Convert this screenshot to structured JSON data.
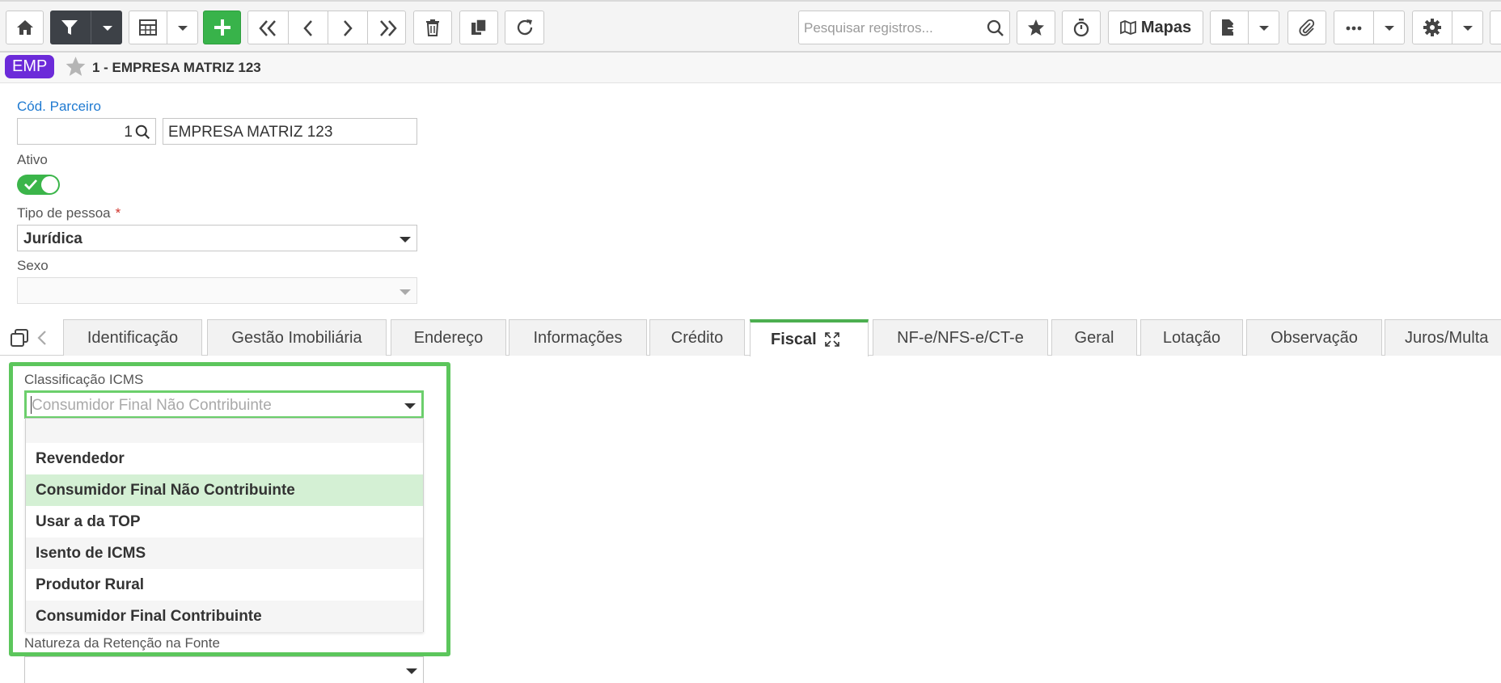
{
  "toolbar": {
    "search_placeholder": "Pesquisar registros...",
    "mapas_label": "Mapas"
  },
  "breadcrumb": {
    "badge": "EMP",
    "title": "1 - EMPRESA MATRIZ 123"
  },
  "form": {
    "partner_label": "Cód. Parceiro",
    "partner_code": "1",
    "partner_name": "EMPRESA MATRIZ 123",
    "active_label": "Ativo",
    "active": true,
    "person_type_label": "Tipo de pessoa",
    "required_mark": "*",
    "person_type_value": "Jurídica",
    "sex_label": "Sexo",
    "sex_value": ""
  },
  "tabs": [
    {
      "label": "Identificação"
    },
    {
      "label": "Gestão Imobiliária"
    },
    {
      "label": "Endereço"
    },
    {
      "label": "Informações"
    },
    {
      "label": "Crédito"
    },
    {
      "label": "Fiscal",
      "active": true
    },
    {
      "label": "NF-e/NFS-e/CT-e"
    },
    {
      "label": "Geral"
    },
    {
      "label": "Lotação"
    },
    {
      "label": "Observação"
    },
    {
      "label": "Juros/Multa"
    }
  ],
  "fiscal": {
    "icms_label": "Classificação ICMS",
    "icms_placeholder": "Consumidor Final Não Contribuinte",
    "icms_options": [
      "",
      "Revendedor",
      "Consumidor Final Não Contribuinte",
      "Usar a da TOP",
      "Isento de ICMS",
      "Produtor Rural",
      "Consumidor Final Contribuinte"
    ],
    "icms_selected_index": 2,
    "retencao_label": "Natureza da Retenção na Fonte"
  },
  "colors": {
    "accent_green": "#38b34a",
    "badge_purple": "#6c2bd9",
    "link_blue": "#1f7ad1",
    "selected_option": "#d4f0d4"
  }
}
